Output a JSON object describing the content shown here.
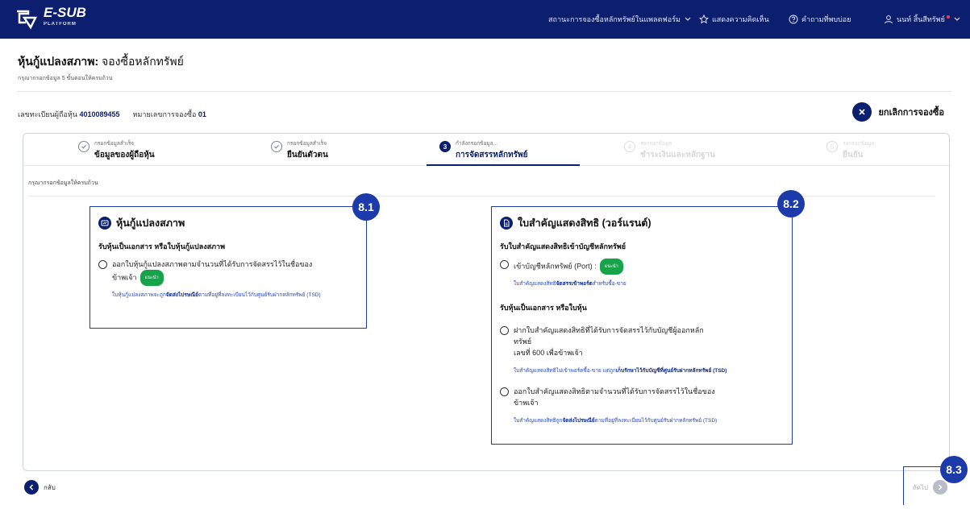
{
  "header": {
    "logo_text": "E-SUB",
    "logo_sub": "PLATFORM",
    "nav_status": "สถานะการจองซื้อหลักทรัพย์ในแพลตฟอร์ม",
    "nav_feedback": "แสดงความคิดเห็น",
    "nav_help": "คำถามที่พบบ่อย",
    "user_name": "นนท์ สิ้นสีทรัพย์"
  },
  "page": {
    "title_bold": "หุ้นกู้แปลงสภาพ:",
    "title_rest": " จองซื้อหลักทรัพย์",
    "hint": "กรุณากรอกข้อมูล 5 ขั้นตอนให้ครบถ้วน"
  },
  "meta": {
    "holder_label": "เลขทะเบียนผู้ถือหุ้น",
    "holder_value": "4010089455",
    "sub_label": "หมายเลขการจองซื้อ",
    "sub_value": "01"
  },
  "cancel_label": "ยกเลิกการจองซื้อ",
  "steps": [
    {
      "small": "กรอกข้อมูลสำเร็จ",
      "label": "ข้อมูลของผู้ถือหุ้น"
    },
    {
      "small": "กรอกข้อมูลสำเร็จ",
      "label": "ยืนยันตัวตน"
    },
    {
      "num": "3",
      "small": "กำลังกรอกข้อมูล...",
      "label": "การจัดสรรหลักทรัพย์"
    },
    {
      "num": "4",
      "small": "รอกรอกข้อมูล",
      "label": "ชำระเงินและหลักฐาน"
    },
    {
      "num": "5",
      "small": "รอกรอกข้อมูล",
      "label": "ยืนยัน"
    }
  ],
  "card_hint": "กรุณากรอกข้อมูลให้ครบถ้วน",
  "box1": {
    "title": "หุ้นกู้แปลงสภาพ",
    "section": "รับหุ้นเป็นเอกสาร หรือใบหุ้นกู้แปลงสภาพ",
    "option_line1": "ออกใบหุ้นกู้แปลงสภาพตามจำนวนที่ได้รับการจัดสรรไว้ในชื่อของ",
    "option_line2": "ข้าพเจ้า",
    "badge": "แนะนำ",
    "note_pre": "ใบหุ้นกู้แปลงสภาพจะถูก",
    "note_bold": "จัดส่งไปรษณีย์",
    "note_post": "ตามที่อยู่ที่ลงทะเบียนไว้กับศูนย์รับฝากหลักทรัพย์ (TSD)"
  },
  "box2": {
    "title": "ใบสำคัญแสดงสิทธิ (วอร์แรนต์)",
    "section1": "รับใบสำคัญแสดงสิทธิเข้าบัญชีหลักทรัพย์",
    "opt1": "เข้าบัญชีหลักทรัพย์ (Port) :",
    "badge": "แนะนำ",
    "note1_pre": "ใบสำคัญแสดงสิทธิ",
    "note1_bold": "จัดสรรเข้าพอร์ต",
    "note1_post": "สำหรับซื้อ-ขาย",
    "section2": "รับหุ้นเป็นเอกสาร หรือใบหุ้น",
    "opt2_line1": "ฝากใบสำคัญแสดงสิทธิที่ได้รับการจัดสรรไว้กับบัญชีผู้ออกหลัก",
    "opt2_line2": "ทรัพย์",
    "opt2_line3": "เลขที่ 600 เพื่อข้าพเจ้า",
    "note2_pre": "ใบสำคัญแสดงสิทธิไม่เข้าพอร์ตซื้อ-ขาย แต่ถูก",
    "note2_bold": "เก็บรักษาไว้กับบัญชีที่ศูนย์รับฝากหลักทรัพย์ (TSD)",
    "opt3_line1": "ออกใบสำคัญแสดงสิทธิตามจำนวนที่ได้รับการจัดสรรไว้ในชื่อของ",
    "opt3_line2": "ข้าพเจ้า",
    "note3_pre": "ใบสำคัญแสดงสิทธิถูก",
    "note3_bold": "จัดส่งไปรษณีย์",
    "note3_post": "ตามที่อยู่ที่ลงทะเบียนไว้กับศูนย์รับฝากหลักทรัพย์ (TSD)"
  },
  "callouts": {
    "c1": "8.1",
    "c2": "8.2",
    "c3": "8.3"
  },
  "footer": {
    "back": "กลับ",
    "next": "ถัดไป"
  },
  "colors": {
    "navy": "#0b1f6e",
    "accent": "#1c3aa9",
    "success": "#16a34a"
  }
}
